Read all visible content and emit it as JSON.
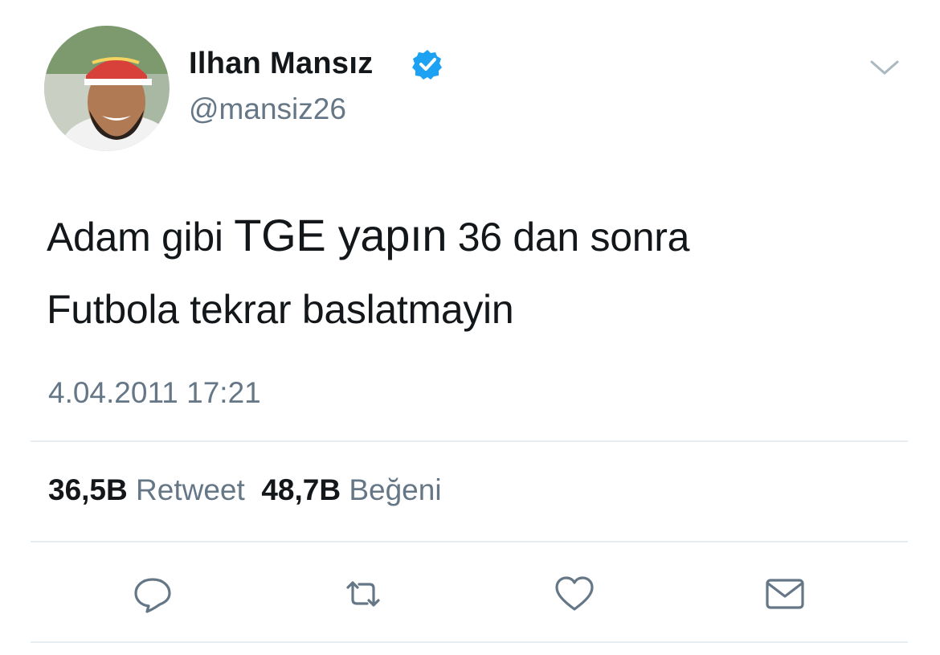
{
  "author": {
    "name": "Ilhan Mansız",
    "handle": "@mansiz26",
    "verified": true,
    "verified_color": "#1da1f2"
  },
  "tweet": {
    "line1": {
      "part1": "Adam gibi ",
      "part2": "TGE yapın",
      "part3": " 36 dan sonra"
    },
    "line2": "Futbola tekrar baslatmayin",
    "timestamp": "4.04.2011 17:21"
  },
  "stats": {
    "retweets_count": "36,5B",
    "retweets_label": "Retweet",
    "likes_count": "48,7B",
    "likes_label": "Beğeni"
  },
  "actions": [
    "reply-icon",
    "retweet-icon",
    "like-icon",
    "message-icon"
  ],
  "colors": {
    "text": "#14171a",
    "secondary": "#657786",
    "divider": "#e6ecf0",
    "icon": "#657786"
  }
}
